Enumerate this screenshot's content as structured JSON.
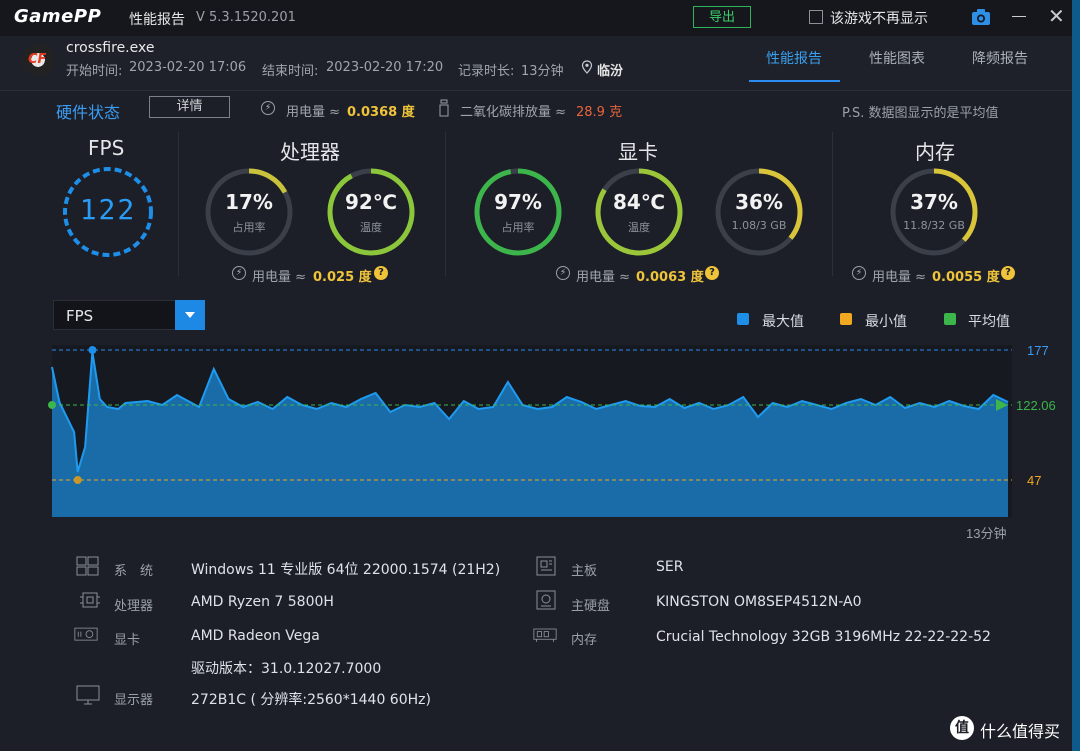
{
  "titlebar": {
    "logo": "GamePP",
    "title": "性能报告",
    "version": "V 5.3.1520.201",
    "export_label": "导出",
    "no_show_label": "该游戏不再显示",
    "close_glyph": "✕"
  },
  "header": {
    "app_icon_text": "CF",
    "process": "crossfire.exe",
    "start_label": "开始时间:",
    "start_time": "2023-02-20 17:06",
    "end_label": "结束时间:",
    "end_time": "2023-02-20 17:20",
    "duration_label": "记录时长:",
    "duration": "13分钟",
    "location": "临汾",
    "tabs": [
      {
        "label": "性能报告",
        "active": true
      },
      {
        "label": "性能图表",
        "active": false
      },
      {
        "label": "降频报告",
        "active": false
      }
    ]
  },
  "status": {
    "title": "硬件状态",
    "detail_button": "详情",
    "power_label": "用电量 ≈",
    "power_value": "0.0368 度",
    "co2_label": "二氧化碳排放量 ≈",
    "co2_value": "28.9 克",
    "note": "P.S. 数据图显示的是平均值",
    "bolt": "⚡"
  },
  "fps_panel": {
    "title": "FPS",
    "value": "122"
  },
  "cpu_panel": {
    "title": "处理器",
    "usage": {
      "value": "17%",
      "label": "占用率",
      "fraction": 0.17
    },
    "temp": {
      "value": "92℃",
      "label": "温度",
      "fraction": 0.92
    },
    "power_label": "用电量 ≈",
    "power_value": "0.025 度",
    "help": "?"
  },
  "gpu_panel": {
    "title": "显卡",
    "usage": {
      "value": "97%",
      "label": "占用率",
      "fraction": 0.97
    },
    "temp": {
      "value": "84℃",
      "label": "温度",
      "fraction": 0.84
    },
    "vram": {
      "value": "36%",
      "label": "1.08/3 GB",
      "fraction": 0.36
    },
    "power_label": "用电量 ≈",
    "power_value": "0.0063 度",
    "help": "?"
  },
  "mem_panel": {
    "title": "内存",
    "usage": {
      "value": "37%",
      "label": "11.8/32 GB",
      "fraction": 0.37
    },
    "power_label": "用电量 ≈",
    "power_value": "0.0055 度",
    "help": "?"
  },
  "chart_controls": {
    "dropdown_value": "FPS",
    "legend": [
      {
        "label": "最大值",
        "color": "#1e8fe8"
      },
      {
        "label": "最小值",
        "color": "#f0a820"
      },
      {
        "label": "平均值",
        "color": "#3cb54a"
      }
    ]
  },
  "chart_data": {
    "type": "area",
    "metric": "FPS",
    "max": 177,
    "min": 47,
    "avg": 122.06,
    "max_label": "177",
    "min_label": "47",
    "avg_label": "122.06",
    "ylim": [
      10,
      182
    ],
    "x_end_label": "13分钟",
    "duration_minutes": 13,
    "fill_color": "#1a6ca8",
    "line_color": "#1e9bf0",
    "x": [
      0,
      0.1,
      0.2,
      0.3,
      0.35,
      0.45,
      0.55,
      0.65,
      0.75,
      0.9,
      1.0,
      1.3,
      1.5,
      1.7,
      2.0,
      2.2,
      2.4,
      2.6,
      2.8,
      3.0,
      3.2,
      3.4,
      3.6,
      3.8,
      4.0,
      4.2,
      4.4,
      4.6,
      4.8,
      5.0,
      5.2,
      5.4,
      5.6,
      5.8,
      6.0,
      6.2,
      6.4,
      6.6,
      6.8,
      7.0,
      7.2,
      7.4,
      7.6,
      7.8,
      8.0,
      8.2,
      8.4,
      8.6,
      8.8,
      9.0,
      9.2,
      9.4,
      9.6,
      9.8,
      10.0,
      10.2,
      10.4,
      10.6,
      10.8,
      11.0,
      11.2,
      11.4,
      11.6,
      11.8,
      12.0,
      12.2,
      12.4,
      12.6,
      12.8,
      13.0
    ],
    "values": [
      160,
      125,
      110,
      95,
      55,
      80,
      175,
      128,
      120,
      118,
      124,
      126,
      122,
      132,
      120,
      158,
      128,
      120,
      125,
      118,
      130,
      122,
      118,
      124,
      120,
      128,
      134,
      115,
      122,
      120,
      124,
      108,
      126,
      118,
      120,
      145,
      122,
      118,
      120,
      130,
      125,
      118,
      122,
      126,
      121,
      120,
      128,
      119,
      124,
      118,
      122,
      130,
      110,
      124,
      120,
      126,
      122,
      118,
      124,
      128,
      122,
      130,
      119,
      124,
      120,
      126,
      121,
      118,
      132,
      125
    ]
  },
  "system_info": {
    "left": [
      {
        "label": "系　统",
        "value": "Windows 11 专业版 64位 22000.1574 (21H2)",
        "icon": "windows-icon"
      },
      {
        "label": "处理器",
        "value": "AMD Ryzen 7 5800H",
        "icon": "cpu-icon"
      },
      {
        "label": "显卡",
        "value": "AMD Radeon Vega",
        "icon": "gpu-icon"
      },
      {
        "label": "",
        "value": "驱动版本：31.0.12027.7000",
        "icon": ""
      },
      {
        "label": "显示器",
        "value": "272B1C ( 分辨率:2560*1440 60Hz)",
        "icon": "monitor-icon"
      }
    ],
    "right": [
      {
        "label": "主板",
        "value": "SER",
        "icon": "motherboard-icon"
      },
      {
        "label": "主硬盘",
        "value": "KINGSTON OM8SEP4512N-A0",
        "icon": "disk-icon"
      },
      {
        "label": "内存",
        "value": "Crucial Technology 32GB 3196MHz 22-22-22-52",
        "icon": "memory-icon"
      }
    ]
  },
  "watermark": {
    "badge": "值",
    "text": "什么值得买"
  }
}
